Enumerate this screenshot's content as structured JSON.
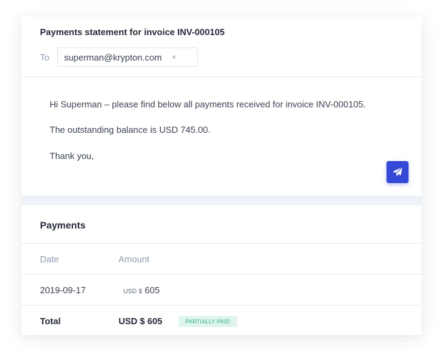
{
  "email": {
    "subject": "Payments statement for invoice INV-000105",
    "to_label": "To",
    "recipient": "superman@krypton.com",
    "remove_glyph": "×",
    "body_line1": "Hi Superman – please find below all payments received for invoice INV-000105.",
    "body_line2": "The outstanding balance is USD 745.00.",
    "body_line3": "Thank you,",
    "send_icon": "paper-plane-icon"
  },
  "payments": {
    "title": "Payments",
    "columns": {
      "date": "Date",
      "amount": "Amount"
    },
    "rows": [
      {
        "date": "2019-09-17",
        "currency": "USD $",
        "amount": "605"
      }
    ],
    "total": {
      "label": "Total",
      "amount": "USD $ 605",
      "status": "PARTIALLY PAID"
    }
  },
  "colors": {
    "accent": "#3549d6",
    "badge_bg": "#dff5ec",
    "badge_text": "#2fae86"
  }
}
